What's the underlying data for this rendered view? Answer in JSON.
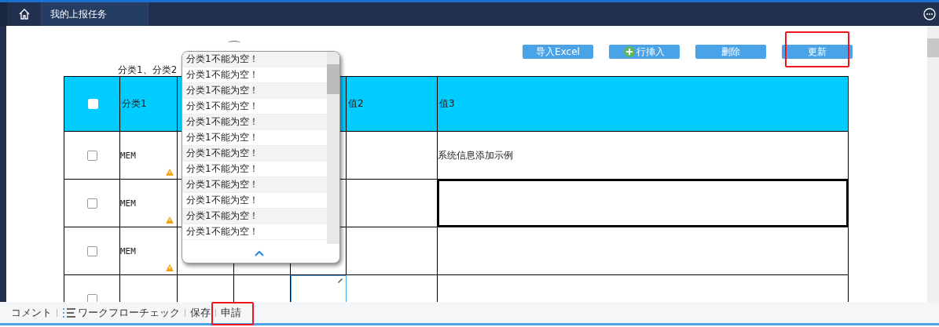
{
  "nav": {
    "tab": "我的上报任务"
  },
  "toolbar": {
    "buttons": [
      {
        "label": "导入Excel",
        "kind": "plain",
        "highlighted": false
      },
      {
        "label": "行挿入",
        "kind": "add",
        "highlighted": false
      },
      {
        "label": "删除",
        "kind": "plain",
        "highlighted": false
      },
      {
        "label": "更新",
        "kind": "plain",
        "highlighted": true
      }
    ]
  },
  "caption": "分类1、分类2",
  "table": {
    "header_checked": false,
    "columns": [
      "分类1",
      "值2",
      "值3"
    ],
    "rows": [
      {
        "checked": false,
        "category1": "MEM",
        "warning": true,
        "value3": "系统信息添加示例",
        "value3_selected": false,
        "editing": false
      },
      {
        "checked": false,
        "category1": "MEM",
        "warning": true,
        "value3": "",
        "value3_selected": true,
        "editing": false
      },
      {
        "checked": false,
        "category1": "MEM",
        "warning": true,
        "value3": "",
        "value3_selected": false,
        "editing": false
      },
      {
        "checked": false,
        "category1": "",
        "warning": false,
        "value3": "",
        "value3_selected": false,
        "editing": true
      }
    ]
  },
  "error_popup": {
    "messages": [
      "分类1不能为空！",
      "分类1不能为空！",
      "分类1不能为空！",
      "分类1不能为空！",
      "分类1不能为空！",
      "分类1不能为空！",
      "分类1不能为空！",
      "分类1不能为空！",
      "分类1不能为空！",
      "分类1不能为空！",
      "分类1不能为空！",
      "分类1不能为空！"
    ]
  },
  "footer": {
    "items": [
      {
        "label": "コメント",
        "kind": "plain",
        "highlighted": false
      },
      {
        "label": "ワークフローチェック",
        "kind": "list",
        "highlighted": false
      },
      {
        "label": "保存",
        "kind": "plain",
        "highlighted": false
      },
      {
        "label": "申請",
        "kind": "plain",
        "highlighted": true
      }
    ]
  }
}
